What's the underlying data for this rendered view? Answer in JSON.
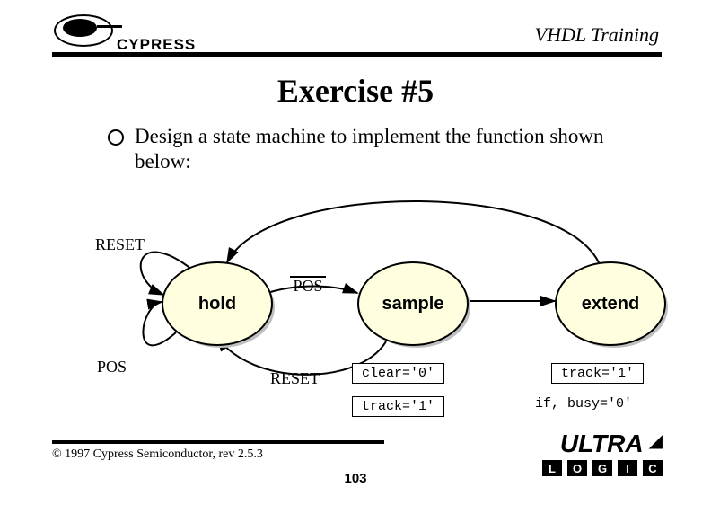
{
  "header": {
    "brand_text": "CYPRESS",
    "course_title": "VHDL Training"
  },
  "title": "Exercise #5",
  "bullet_text": "Design a state machine to implement the function shown below:",
  "diagram": {
    "states": {
      "hold": {
        "label": "hold"
      },
      "sample": {
        "label": "sample"
      },
      "extend": {
        "label": "extend"
      }
    },
    "transition_labels": {
      "reset_self_top": "RESET",
      "reset_from_sample": "RESET",
      "pos_self": "POS",
      "not_pos": "POS"
    },
    "outputs": {
      "sample_clear": "clear='0'",
      "sample_track": "track='1'",
      "extend_track": "track='1'",
      "extend_if": "if, busy='0'"
    }
  },
  "footer": {
    "copyright": "© 1997 Cypress Semiconductor, rev 2.5.3",
    "page": "103",
    "ultra_word": "ULTRA",
    "ultra_blocks": [
      "L",
      "O",
      "G",
      "I",
      "C"
    ],
    "ultra_caret": "◢"
  }
}
